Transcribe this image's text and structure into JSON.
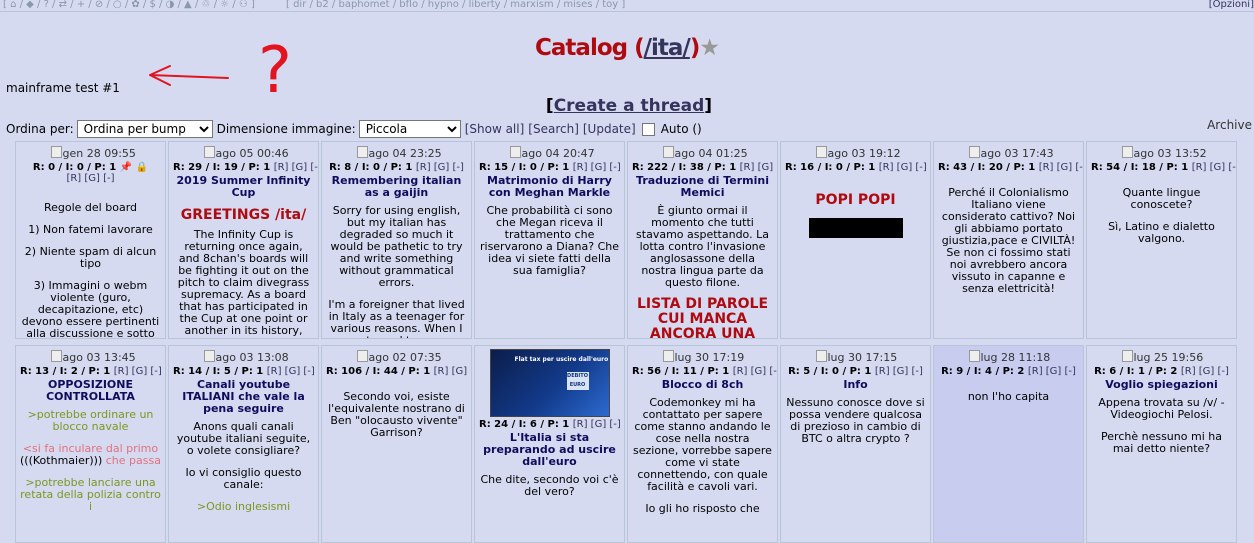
{
  "topbar": {
    "icons": "[ ⌂ / ◆ / ? / ⇄ / + / ⊘ / ○ / ✿ / $ / ◑ / ▲ / ♲ / ☼ / ⚇ ]",
    "boards": "[ dir / b2 / baphomet / bflo / hypno / liberty / marxism / mises / toy ]",
    "options": "[Opzioni]"
  },
  "title": {
    "prefix": "Catalog (",
    "board": "/ita/",
    "suffix": ")"
  },
  "mainframe": "mainframe test #1",
  "annotation": {
    "question": "?"
  },
  "create_thread": "Create a thread",
  "controls": {
    "sort_label": "Ordina per:",
    "sort_value": "Ordina per bump",
    "size_label": "Dimensione immagine:",
    "size_value": "Piccola",
    "show_all": "[Show all]",
    "search": "[Search]",
    "update": "[Update]",
    "auto": "Auto ()",
    "archive": "Archive"
  },
  "threads": [
    {
      "date": "gen 28 09:55",
      "stats": "R: 0 / I: 0 / P: 1",
      "links": "[R] [G] [-]",
      "pinned": true,
      "locked": true,
      "subject": "",
      "body": [
        "Regole del board",
        "1) Non fatemi lavorare",
        "2) Niente spam di alcun tipo",
        "3) Immagini o webm violente (guro, decapitazione, etc) devono essere pertinenti alla discussione e sotto spoiler"
      ]
    },
    {
      "date": "ago 05 00:46",
      "stats": "R: 29 / I: 19 / P: 1",
      "links": "[R] [G] [-]",
      "subject": "2019 Summer Infinity Cup",
      "greet": "GREETINGS /ita/",
      "body": [
        "The Infinity Cup is returning once again, and 8chan's boards will be fighting it out on the pitch to claim divegrass supremacy. As a board that has participated in the Cup at one point or another in its history, you are invited to the reveal"
      ]
    },
    {
      "date": "ago 04 23:25",
      "stats": "R: 8 / I: 0 / P: 1",
      "links": "[R] [G] [-]",
      "subject": "Remembering italian as a gaijin",
      "body": [
        "Sorry for using english, but my italian has degraded so much it would be pathetic to try and write something without grammatical errors.",
        "I'm a foreigner that lived in Italy as a teenager for various reasons. When I returned to my homeland, I"
      ]
    },
    {
      "date": "ago 04 20:47",
      "stats": "R: 15 / I: 0 / P: 1",
      "links": "[R] [G] [-]",
      "subject": "Matrimonio di Harry con Meghan Markle",
      "body": [
        "Che probabilità ci sono che Megan riceva il trattamento che riservarono a Diana? Che idea vi siete fatti della sua famiglia?"
      ]
    },
    {
      "date": "ago 04 01:25",
      "stats": "R: 222 / I: 38 / P: 1",
      "links": "[R] [G] [-]",
      "subject": "Traduzione di Termini Memici",
      "body": [
        "È giunto ormai il momento che tutti stavamo aspettando. La lotta contro l'invasione anglosassone della nostra lingua parte da questo filone."
      ],
      "heading": "LISTA DI PAROLE CUI MANCA ANCORA UNA"
    },
    {
      "date": "ago 03 19:12",
      "stats": "R: 16 / I: 0 / P: 1",
      "links": "[R] [G] [-]",
      "subject": "",
      "big": "POPI POPI",
      "redacted": true,
      "body": []
    },
    {
      "date": "ago 03 17:43",
      "stats": "R: 43 / I: 20 / P: 1",
      "links": "[R] [G] [-]",
      "subject": "",
      "body": [
        "Perché il Colonialismo Italiano viene considerato cattivo? Noi gli abbiamo portato giustizia,pace e CIVILTÀ! Se non ci fossimo stati noi avrebbero ancora vissuto in capanne e senza elettricità!"
      ]
    },
    {
      "date": "ago 03 13:52",
      "stats": "R: 54 / I: 18 / P: 1",
      "links": "[R] [G] [-]",
      "subject": "",
      "body": [
        "Quante lingue conoscete?",
        "Sì, Latino e dialetto valgono."
      ]
    },
    {
      "date": "ago 03 13:45",
      "stats": "R: 13 / I: 2 / P: 1",
      "links": "[R] [G] [-]",
      "subject": "OPPOSIZIONE CONTROLLATA",
      "rich": [
        {
          "cls": "green",
          "t": ">potrebbe ordinare un blocco navale"
        },
        {
          "cls": "pink",
          "t": "<si fa inculare dal primo"
        },
        {
          "cls": "mixed",
          "a": "(((Kothmaier)))",
          "b": " che passa"
        },
        {
          "cls": "green",
          "t": ">potrebbe lanciare una retata della polizia contro i"
        }
      ]
    },
    {
      "date": "ago 03 13:08",
      "stats": "R: 14 / I: 5 / P: 1",
      "links": "[R] [G] [-]",
      "subject": "Canali youtube ITALIANI che vale la pena seguire",
      "body": [
        "Anons quali canali youtube italiani seguite, o volete consigliare?",
        "Io vi consiglio questo canale:"
      ],
      "tail_green": ">Odio inglesismi"
    },
    {
      "date": "ago 02 07:35",
      "stats": "R: 106 / I: 44 / P: 1",
      "links": "[R] [G] [-]",
      "subject": "",
      "body": [
        "Secondo voi, esiste l'equivalente nostrano di Ben \"olocausto vivente\" Garrison?"
      ]
    },
    {
      "image": true,
      "img_title": "Flat tax per uscire dall'euro",
      "img_box": "DEBITO EURO",
      "stats": "R: 24 / I: 6 / P: 1",
      "links": "[R] [G] [-]",
      "subject": "L'Italia si sta preparando ad uscire dall'euro",
      "body": [
        "Che dite, secondo voi c'è del vero?"
      ]
    },
    {
      "date": "lug 30 17:19",
      "stats": "R: 56 / I: 11 / P: 1",
      "links": "[R] [G] [-]",
      "subject": "Blocco di 8ch",
      "body": [
        "Codemonkey mi ha contattato per sapere come stanno andando le cose nella nostra sezione, vorrebbe sapere come vi state connettendo, con quale facilità e cavoli vari.",
        "Io gli ho risposto che"
      ]
    },
    {
      "date": "lug 30 17:15",
      "stats": "R: 5 / I: 0 / P: 1",
      "links": "[R] [G] [-]",
      "subject": "Info",
      "body": [
        "Nessuno conosce dove si possa vendere qualcosa di prezioso in cambio di BTC o altra crypto ?"
      ]
    },
    {
      "date": "lug 28 11:18",
      "stats": "R: 9 / I: 4 / P: 2",
      "links": "[R] [G] [-]",
      "subject": "",
      "highlight": true,
      "body": [
        "non l'ho capita"
      ]
    },
    {
      "date": "lug 25 19:56",
      "stats": "R: 6 / I: 1 / P: 2",
      "links": "[R] [G] [-]",
      "subject": "Voglio spiegazioni",
      "body": [
        "Appena trovata su /v/ - Videogiochi Pelosi.",
        "Perchè nessuno mi ha mai detto niente?"
      ]
    }
  ]
}
